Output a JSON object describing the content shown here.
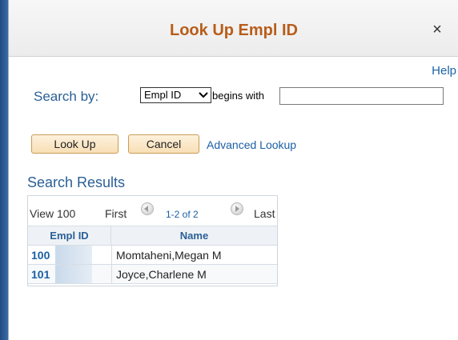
{
  "dialog": {
    "title": "Look Up Empl ID",
    "close_glyph": "×",
    "help_link": "Help"
  },
  "search": {
    "label": "Search by:",
    "field_select": "Empl ID",
    "operator": "begins with",
    "value": "",
    "placeholder": ""
  },
  "buttons": {
    "lookup": "Look Up",
    "cancel": "Cancel",
    "advanced": "Advanced Lookup"
  },
  "results": {
    "title": "Search Results",
    "nav": {
      "view": "View 100",
      "first": "First",
      "count": "1-2 of 2",
      "last": "Last"
    },
    "columns": [
      "Empl ID",
      "Name"
    ],
    "rows": [
      {
        "id": "100",
        "name": "Momtaheni,Megan M"
      },
      {
        "id": "101",
        "name": "Joyce,Charlene M"
      }
    ]
  },
  "colors": {
    "title": "#b85d1a",
    "link": "#1b5fa3",
    "label": "#2a5f96",
    "button_bg": "#f8dfb5"
  },
  "icons": {
    "close": "close-icon",
    "prev": "previous-arrow-icon",
    "next": "next-arrow-icon",
    "dropdown": "chevron-down-icon"
  }
}
